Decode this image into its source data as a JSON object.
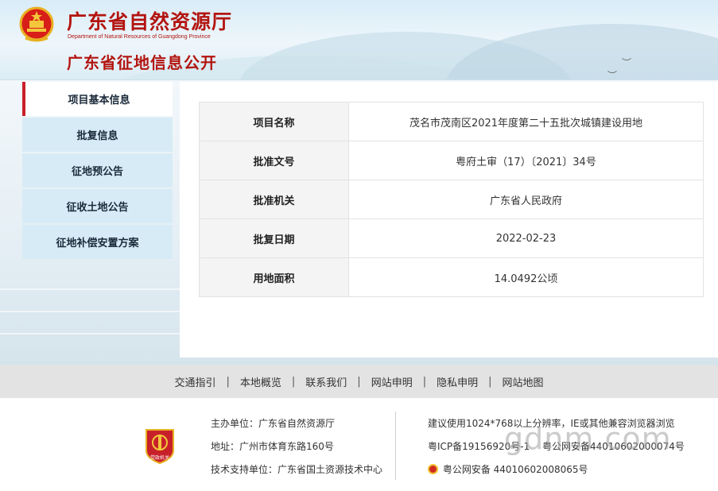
{
  "header": {
    "site_title": "广东省自然资源厅",
    "site_subtitle": "Department of Natural Resources of Guangdong Province",
    "page_heading": "广东省征地信息公开"
  },
  "sidebar": {
    "items": [
      {
        "label": "项目基本信息",
        "active": true
      },
      {
        "label": "批复信息",
        "active": false
      },
      {
        "label": "征地预公告",
        "active": false
      },
      {
        "label": "征收土地公告",
        "active": false
      },
      {
        "label": "征地补偿安置方案",
        "active": false
      }
    ]
  },
  "project_info": {
    "rows": [
      {
        "label": "项目名称",
        "value": "茂名市茂南区2021年度第二十五批次城镇建设用地"
      },
      {
        "label": "批准文号",
        "value": "粤府土审（17）〔2021〕34号"
      },
      {
        "label": "批准机关",
        "value": "广东省人民政府"
      },
      {
        "label": "批复日期",
        "value": "2022-02-23"
      },
      {
        "label": "用地面积",
        "value": "14.0492公顷"
      }
    ]
  },
  "footer_nav": {
    "links": [
      "交通指引",
      "本地概览",
      "联系我们",
      "网站申明",
      "隐私申明",
      "网站地图"
    ],
    "separator": "|"
  },
  "footer_info": {
    "sponsor": "主办单位：广东省自然资源厅",
    "address": "地址：广州市体育东路160号",
    "tech_support": "技术支持单位：广东省国土资源技术中心",
    "browser_note": "建议使用1024*768以上分辨率，IE或其他兼容浏览器浏览",
    "icp": "粤ICP备19156920号-1",
    "icp_tail": "粤公网安备44010602000074号",
    "police_record": "粤公网安备 44010602008065号",
    "watermark": "gdnm.com",
    "badge_text": "党政机关"
  },
  "colors": {
    "brand_red": "#b3140f",
    "sidebar_bg": "#d7ebf6",
    "active_marker": "#c8202a"
  },
  "icons": {
    "emblem": "national-emblem-icon",
    "badge": "party-government-badge-icon",
    "police": "public-security-icon"
  }
}
